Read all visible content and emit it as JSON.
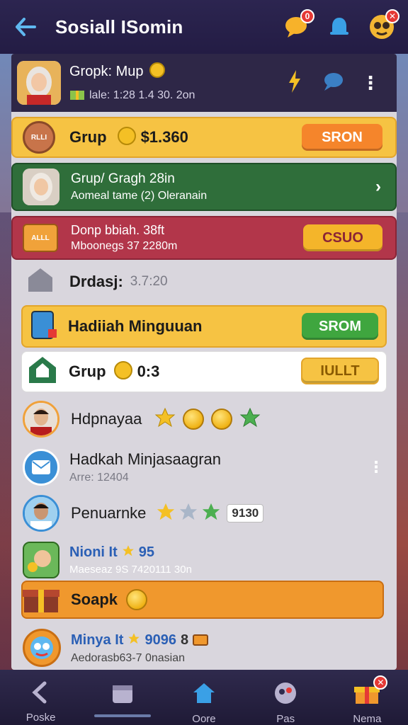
{
  "header": {
    "title": "Sosiall ISomin",
    "notif_badge": "0",
    "profile_badge": "✕"
  },
  "profile_card": {
    "name": "Gropk: Mup",
    "meta": "lale: 1:28 1.4 30. 2on"
  },
  "rows": {
    "grup_coins": {
      "label": "Grup",
      "value": "$1.360",
      "button": "SRON",
      "icon_text": "RLLI"
    },
    "group_green": {
      "line1": "Grup/ Gragh 28in",
      "line2": "Aomeal tame (2) Oleranain"
    },
    "group_red": {
      "line1": "Donp bbiah. 38ft",
      "line2": "Mboonegs 37 2280m",
      "button": "CSUO",
      "icon_text": "ALLL"
    },
    "drdasj": {
      "label": "Drdasj:",
      "time": "3.7:20"
    },
    "hadiah": {
      "label": "Hadiiah Minguuan",
      "button": "SROM"
    },
    "grup_white": {
      "label": "Grup",
      "value": "0:3",
      "button": "IULLT"
    },
    "hdpnayaa": {
      "label": "Hdpnayaa"
    },
    "hadkah": {
      "line1": "Hadkah Minjasaagran",
      "line2": "Arre: 12404"
    },
    "penuarnke": {
      "label": "Penuarnke",
      "value": "9130"
    },
    "nioni": {
      "line1": "Nioni It",
      "score": "95",
      "line2": "Maeseaz 9S 7420111 30n"
    },
    "soapk": {
      "label": "Soapk"
    },
    "minya": {
      "line1": "Minya It",
      "score": "9096",
      "extra": "8",
      "line2": "Aedorasb63-7 0nasian"
    }
  },
  "bottom_nav": [
    {
      "label": "Poske"
    },
    {
      "label": ""
    },
    {
      "label": "Oore"
    },
    {
      "label": "Pas"
    },
    {
      "label": "Nema",
      "badge": "✕"
    }
  ],
  "colors": {
    "topbar": "#2c2550",
    "yellow_card": "#f6c343",
    "green_card": "#2f6e3a",
    "red_card": "#b2364a",
    "orange_button": "#f5852b",
    "green_button": "#3fa63f"
  }
}
